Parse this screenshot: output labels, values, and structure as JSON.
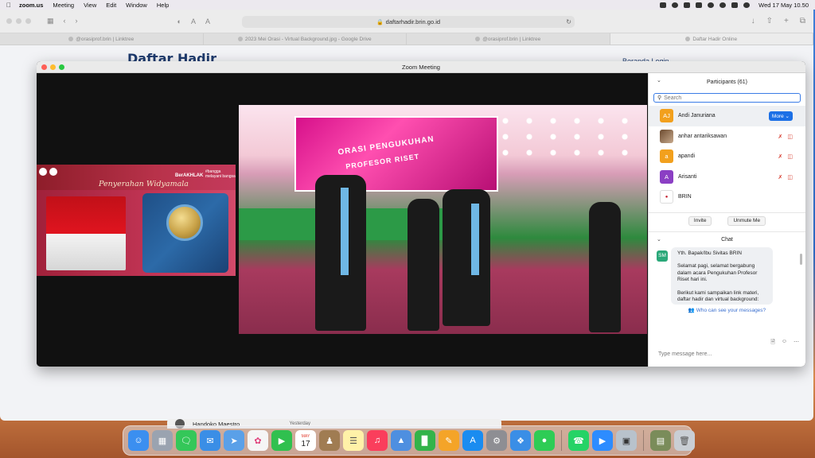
{
  "menubar": {
    "app_name": "zoom.us",
    "menus": [
      "Meeting",
      "View",
      "Edit",
      "Window",
      "Help"
    ],
    "clock": "Wed 17 May  10.50"
  },
  "safari": {
    "url": "daftarhadir.brin.go.id",
    "tabs": [
      "@orasiprof.brin | Linktree",
      "2023 Mei Orasi - Virtual Background.jpg - Google Drive",
      "@orasiprof.brin | Linktree",
      "Daftar Hadir Online"
    ],
    "page_heading": "Daftar Hadir",
    "page_heading_right": "Beranda  Login"
  },
  "zoom": {
    "title": "Zoom Meeting",
    "shared_banner": {
      "title": "Penyerahan Widyamala",
      "akhlak": "BerAKHLAK",
      "bangga": "#bangga melayani bangsa"
    },
    "stage_banner": {
      "line1": "ORASI PENGUKUHAN",
      "line2": "PROFESOR RISET"
    },
    "participants": {
      "header": "Participants (61)",
      "search_placeholder": "Search",
      "more_label": "More",
      "list": [
        {
          "initials": "AJ",
          "name": "Andi Januriana",
          "avatar": "orange"
        },
        {
          "initials": "",
          "name": "anhar antariksawan",
          "avatar": "photo"
        },
        {
          "initials": "a",
          "name": "apandi",
          "avatar": "orange"
        },
        {
          "initials": "A",
          "name": "Arisanti",
          "avatar": "purple"
        },
        {
          "initials": "",
          "name": "BRIN",
          "avatar": "brin"
        }
      ],
      "invite_label": "Invite",
      "unmute_label": "Unmute Me"
    },
    "chat": {
      "header": "Chat",
      "sender_initials": "SM",
      "message": [
        "Yth. Bapak/Ibu Sivitas BRIN",
        "Selamat pagi, selamat bergabung dalam acara Pengukuhan Profesor Riset hari ini.",
        "Berikut kami sampaikan link materi, daftar hadir dan virtual background:"
      ],
      "who_can_see": "Who can see your messages?",
      "input_placeholder": "Type message here..."
    }
  },
  "mail_peek": {
    "sender": "Handoko Maestro",
    "date": "Yesterday"
  },
  "dock": {
    "calendar_month": "MAY",
    "calendar_day": "17"
  }
}
